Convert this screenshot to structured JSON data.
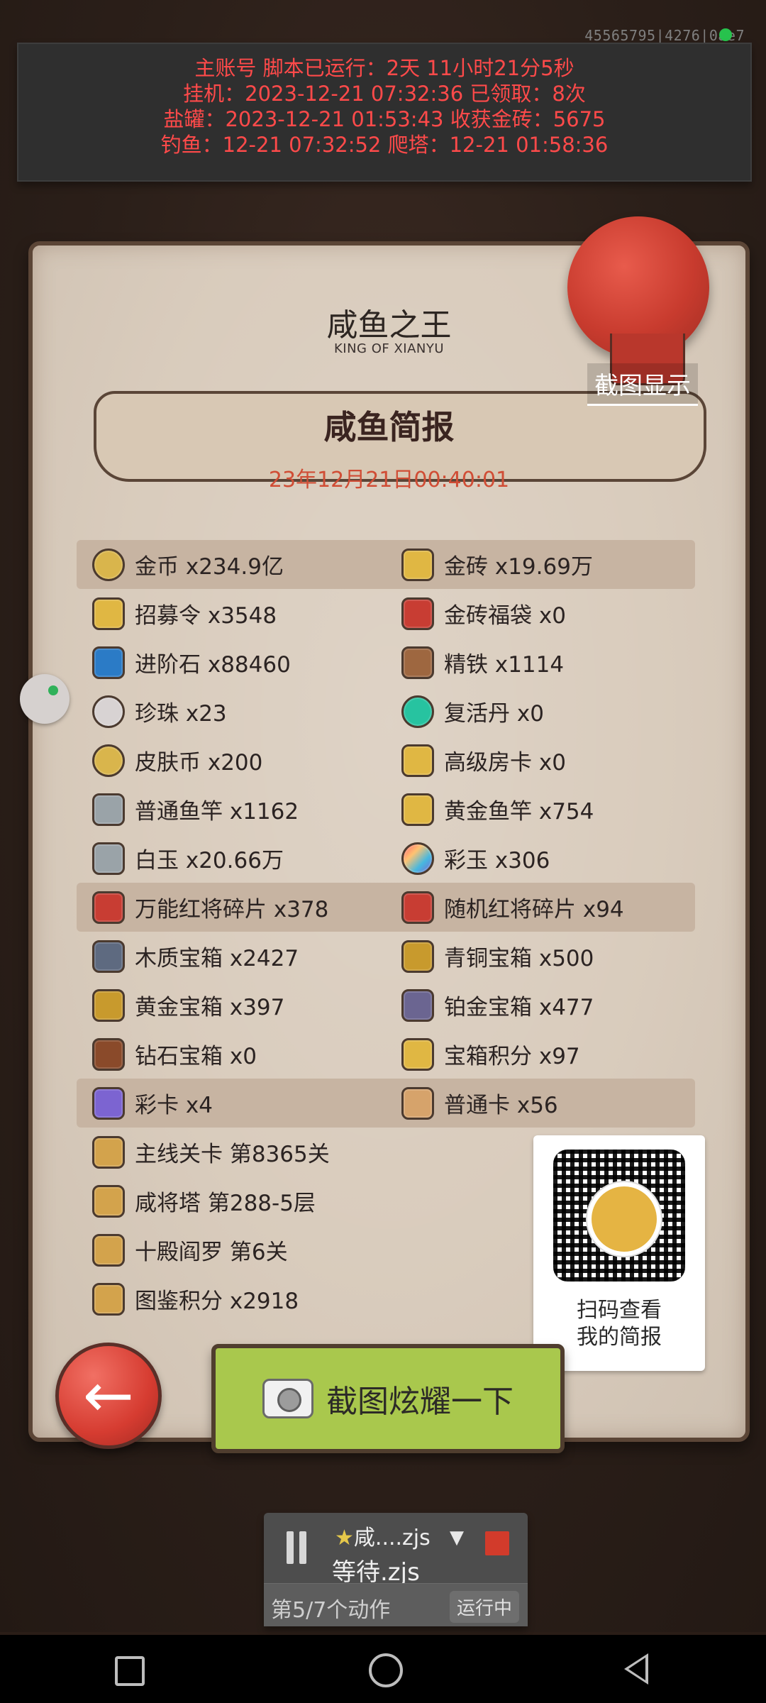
{
  "top_right": {
    "device_id": "45565795|4276|0ae7"
  },
  "overlay": {
    "lines": [
      "主账号 脚本已运行：2天 11小时21分5秒",
      "挂机：2023-12-21 07:32:36 已领取：8次",
      "盐罐：2023-12-21 01:53:43 收获金砖：5675",
      "钓鱼：12-21 07:32:52 爬塔：12-21 01:58:36"
    ]
  },
  "header": {
    "title_cn": "咸鱼之王",
    "title_en": "KING OF XIANYU",
    "seal_button": "截图显示"
  },
  "report": {
    "title": "咸鱼简报",
    "date": "23年12月21日00:40:01"
  },
  "items": [
    {
      "left": "金币 x234.9亿",
      "right": "金砖 x19.69万",
      "highlight": true
    },
    {
      "left": "招募令 x3548",
      "right": "金砖福袋 x0",
      "highlight": false
    },
    {
      "left": "进阶石 x88460",
      "right": "精铁 x1114",
      "highlight": false
    },
    {
      "left": "珍珠 x23",
      "right": "复活丹 x0",
      "highlight": false
    },
    {
      "left": "皮肤币 x200",
      "right": "高级房卡 x0",
      "highlight": false
    },
    {
      "left": "普通鱼竿 x1162",
      "right": "黄金鱼竿 x754",
      "highlight": false
    },
    {
      "left": "白玉 x20.66万",
      "right": "彩玉 x306",
      "highlight": false
    },
    {
      "left": "万能红将碎片 x378",
      "right": "随机红将碎片 x94",
      "highlight": true
    },
    {
      "left": "木质宝箱 x2427",
      "right": "青铜宝箱 x500",
      "highlight": false
    },
    {
      "left": "黄金宝箱 x397",
      "right": "铂金宝箱 x477",
      "highlight": false
    },
    {
      "left": "钻石宝箱 x0",
      "right": "宝箱积分 x97",
      "highlight": false
    },
    {
      "left": "彩卡 x4",
      "right": "普通卡 x56",
      "highlight": true
    }
  ],
  "progress_items": [
    "主线关卡 第8365关",
    "咸将塔 第288-5层",
    "十殿阎罗 第6关",
    "图鉴积分 x2918"
  ],
  "qr": {
    "text_line1": "扫码查看",
    "text_line2": "我的简报"
  },
  "share_button": {
    "label": "截图炫耀一下"
  },
  "script_panel": {
    "name": "咸....zjs",
    "status": "等待.zjs",
    "progress": "第5/7个动作",
    "run_label": "运行中"
  },
  "icons": {
    "back": "back-arrow-icon",
    "camera": "camera-icon",
    "pause": "pause-icon",
    "stop": "stop-icon",
    "dropdown": "chevron-down-icon"
  },
  "colors": {
    "overlay_text": "#ff4a4a",
    "date_text": "#d04d35",
    "share_button": "#a9c84d",
    "back_button": "#d63c31",
    "seal": "#c83b2e"
  }
}
